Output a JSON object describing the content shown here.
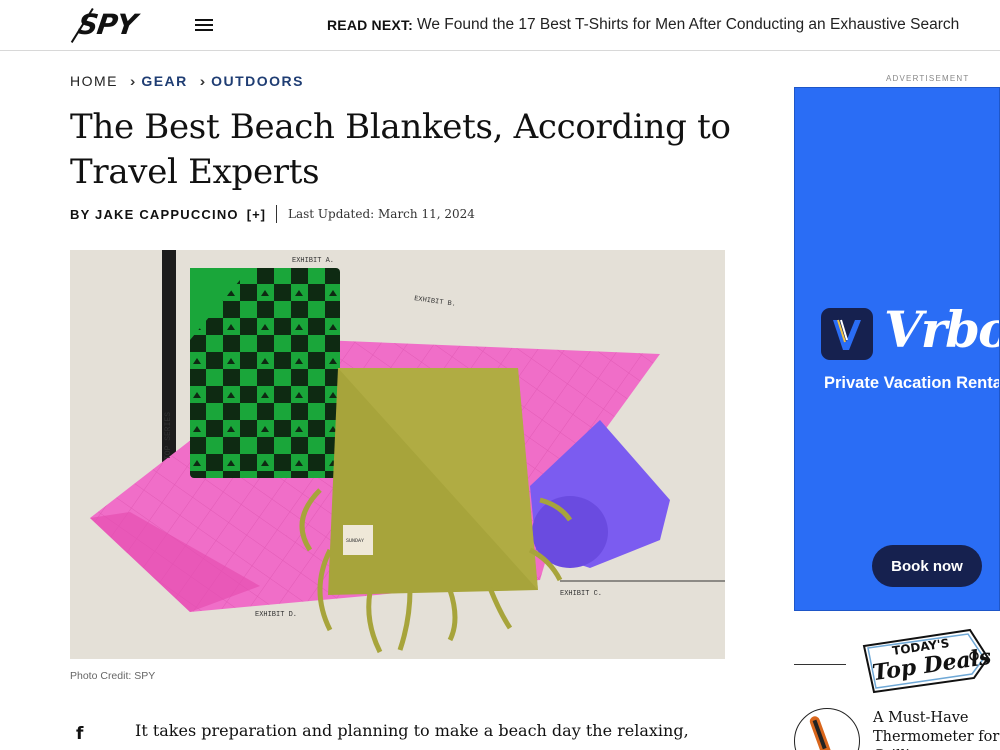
{
  "header": {
    "logo_text": "SPY",
    "menu_icon": "hamburger-menu-icon",
    "read_next_label": "READ NEXT:",
    "read_next_link": "We Found the 17 Best T-Shirts for Men After Conducting an Exhaustive Search"
  },
  "breadcrumb": {
    "home": "HOME",
    "items": [
      "GEAR",
      "OUTDOORS"
    ],
    "separator_icon": "double-chevron-right-icon"
  },
  "article": {
    "title": "The Best Beach Blankets, According to Travel Experts",
    "byline": "BY JAKE CAPPUCCINO",
    "byline_expand": "[+]",
    "last_updated": "Last Updated: March 11, 2024",
    "photo_credit": "Photo Credit: SPY",
    "intro_text": "It takes preparation and planning to make a beach day the relaxing,",
    "share_icon": "facebook-icon"
  },
  "hero_image": {
    "labels": [
      "EXHIBIT A.",
      "EXHIBIT B.",
      "EXHIBIT C.",
      "EXHIBIT D."
    ],
    "tag_text": "SUNDAY",
    "side_text": "TOP SERIES"
  },
  "sidebar": {
    "ad_label": "ADVERTISEMENT",
    "ad": {
      "brand": "Vrbo",
      "tagline": "Private Vacation Rentals",
      "cta": "Book now",
      "bg_color": "#2a6df5",
      "dark_color": "#16214f"
    },
    "deals": {
      "small": "TODAY'S",
      "big": "Top Deals",
      "item_title": "A Must-Have Thermometer for Grilling"
    }
  },
  "colors": {
    "breadcrumb_link": "#1f3d73",
    "pink": "#f06ec8",
    "green": "#1aa63a",
    "olive": "#a7a43b",
    "purple": "#7b5cf0"
  }
}
